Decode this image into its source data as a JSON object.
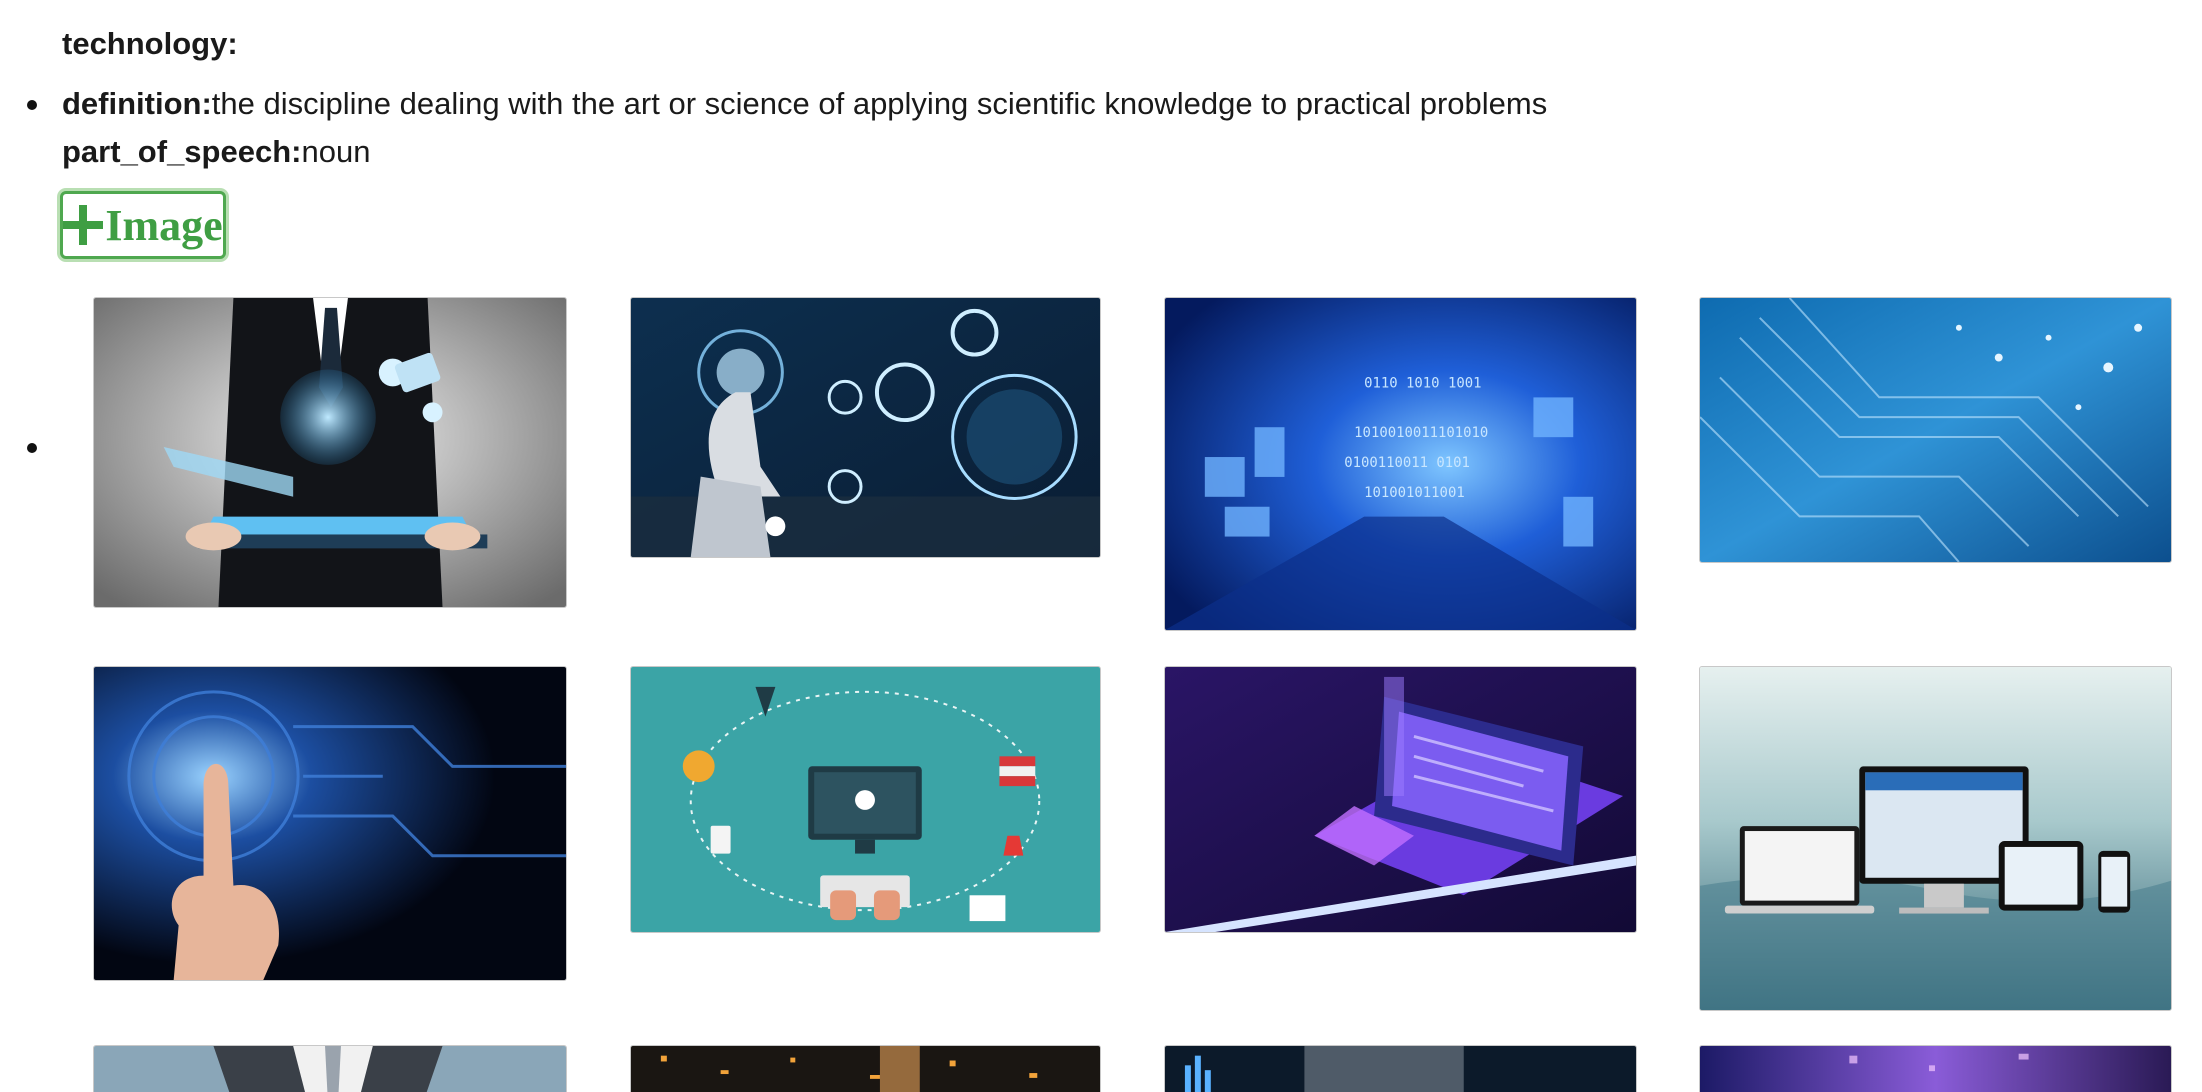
{
  "term": "technology:",
  "entries": [
    {
      "definition_label": "definition:",
      "definition": "the discipline dealing with the art or science of applying scientific knowledge to practical problems",
      "part_of_speech_label": "part_of_speech:",
      "part_of_speech": "noun"
    }
  ],
  "add_image_button": {
    "label": "Image",
    "icon": "plus-icon",
    "color": "#3f9e43"
  },
  "images": [
    {
      "subject": "businessman-holding-tablet-with-globe-hologram"
    },
    {
      "subject": "robot-hand-touching-digital-interface"
    },
    {
      "subject": "blue-binary-code-tunnel"
    },
    {
      "subject": "blue-circuit-board"
    },
    {
      "subject": "finger-touching-fingerprint-circuit"
    },
    {
      "subject": "teal-flat-computer-education-icons"
    },
    {
      "subject": "isometric-laptop-with-dashboard"
    },
    {
      "subject": "responsive-website-on-devices"
    },
    {
      "subject": "businessman-partial"
    },
    {
      "subject": "orange-circuit-lights"
    },
    {
      "subject": "dark-tech-chart-partial"
    },
    {
      "subject": "purple-blue-abstract-partial"
    }
  ]
}
